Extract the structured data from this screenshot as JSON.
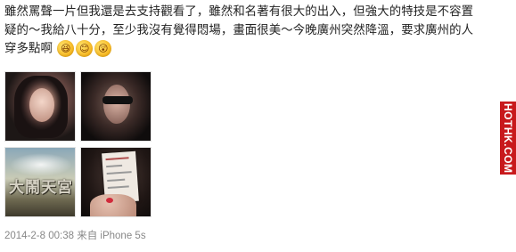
{
  "post": {
    "line1": "雖然罵聲一片但我還是去支持觀看了，雖然和名著有很大的出入，但強大的特技是不容置",
    "line2": "疑的～我給八十分，至少我沒有覺得悶場，畫面很美～今晚廣州突然降溫，要求廣州的人",
    "line3": "穿多點啊",
    "emojis": [
      {
        "icon": "laughing-emoji-icon",
        "glyph": "😆"
      },
      {
        "icon": "grinning-emoji-icon",
        "glyph": "😊"
      },
      {
        "icon": "surprised-emoji-icon",
        "glyph": "😲"
      }
    ]
  },
  "photos": [
    {
      "name": "photo-selfie-1"
    },
    {
      "name": "photo-selfie-sunglasses"
    },
    {
      "name": "photo-movie-poster",
      "text": "大鬧天宮"
    },
    {
      "name": "photo-cinema-ticket"
    }
  ],
  "meta": {
    "timestamp": "2014-2-8 00:38",
    "source": "来自 iPhone 5s"
  },
  "watermark": {
    "text": "HOTHK.COM",
    "color": "#c8191c"
  }
}
